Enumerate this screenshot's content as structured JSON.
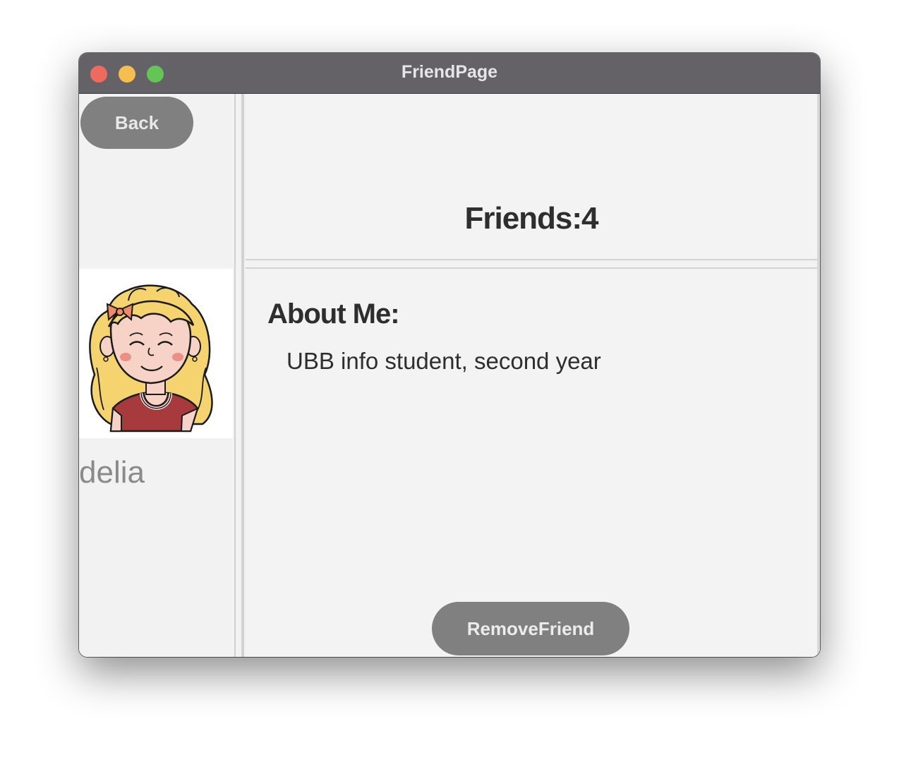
{
  "window": {
    "title": "FriendPage",
    "controls": {
      "close": "close-button",
      "minimize": "minimize-button",
      "maximize": "maximize-button"
    }
  },
  "sidebar": {
    "back_label": "Back",
    "avatar_icon": "girl-avatar-icon",
    "username": "delia"
  },
  "header": {
    "friends_count": "Friends:4"
  },
  "about": {
    "heading": "About Me:",
    "text": "UBB info student, second year"
  },
  "actions": {
    "remove_label": "RemoveFriend"
  },
  "colors": {
    "titlebar": "#646267",
    "button_bg": "#808080",
    "content_bg": "#f2f2f2"
  }
}
